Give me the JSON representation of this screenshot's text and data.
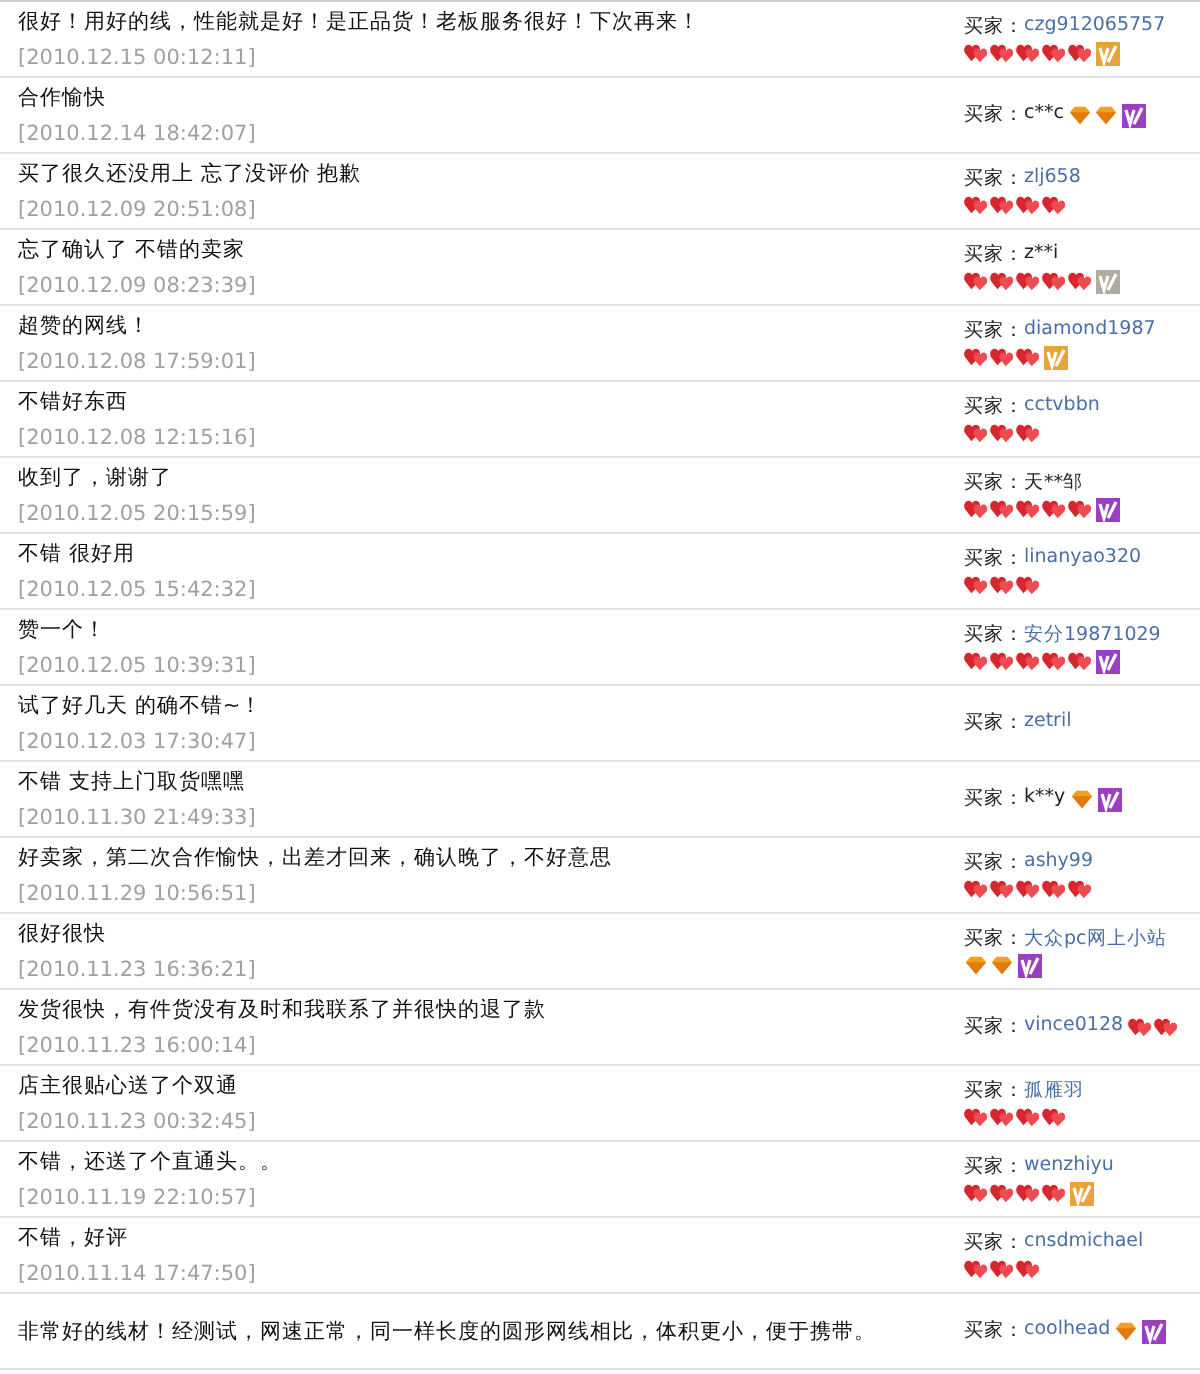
{
  "reviews": [
    {
      "comment": "很好！用好的线，性能就是好！是正品货！老板服务很好！下次再来！",
      "time": "[2010.12.15 00:12:11]",
      "buyer_label": "买家：",
      "buyer": "czg912065757",
      "masked": false,
      "rank_icons": [
        {
          "kind": "heart"
        },
        {
          "kind": "heart"
        },
        {
          "kind": "heart"
        },
        {
          "kind": "heart"
        },
        {
          "kind": "heart"
        }
      ],
      "vip": {
        "color": "#e8a33a"
      },
      "rank_inline": false
    },
    {
      "comment": "合作愉快",
      "time": "[2010.12.14 18:42:07]",
      "buyer_label": "买家：",
      "buyer": "c**c",
      "masked": true,
      "rank_icons": [
        {
          "kind": "diamond"
        },
        {
          "kind": "diamond"
        }
      ],
      "vip": {
        "color": "#9b3fc2"
      },
      "rank_inline": true
    },
    {
      "comment": "买了很久还没用上 忘了没评价 抱歉",
      "time": "[2010.12.09 20:51:08]",
      "buyer_label": "买家：",
      "buyer": "zlj658",
      "masked": false,
      "rank_icons": [
        {
          "kind": "heart"
        },
        {
          "kind": "heart"
        },
        {
          "kind": "heart"
        },
        {
          "kind": "heart"
        }
      ],
      "rank_inline": false
    },
    {
      "comment": "忘了确认了 不错的卖家",
      "time": "[2010.12.09 08:23:39]",
      "buyer_label": "买家：",
      "buyer": "z**i",
      "masked": true,
      "rank_icons": [
        {
          "kind": "heart"
        },
        {
          "kind": "heart"
        },
        {
          "kind": "heart"
        },
        {
          "kind": "heart"
        },
        {
          "kind": "heart"
        }
      ],
      "vip": {
        "color": "#b0aca0"
      },
      "rank_inline": false
    },
    {
      "comment": "超赞的网线！",
      "time": "[2010.12.08 17:59:01]",
      "buyer_label": "买家：",
      "buyer": "diamond1987",
      "masked": false,
      "rank_icons": [
        {
          "kind": "heart"
        },
        {
          "kind": "heart"
        },
        {
          "kind": "heart"
        }
      ],
      "vip": {
        "color": "#e8a33a"
      },
      "rank_inline": false
    },
    {
      "comment": "不错好东西",
      "time": "[2010.12.08 12:15:16]",
      "buyer_label": "买家：",
      "buyer": "cctvbbn",
      "masked": false,
      "rank_icons": [
        {
          "kind": "heart"
        },
        {
          "kind": "heart"
        },
        {
          "kind": "heart"
        }
      ],
      "rank_inline": false
    },
    {
      "comment": "收到了，谢谢了",
      "time": "[2010.12.05 20:15:59]",
      "buyer_label": "买家：",
      "buyer": "天**邹",
      "masked": true,
      "rank_icons": [
        {
          "kind": "heart"
        },
        {
          "kind": "heart"
        },
        {
          "kind": "heart"
        },
        {
          "kind": "heart"
        },
        {
          "kind": "heart"
        }
      ],
      "vip": {
        "color": "#9b3fc2"
      },
      "rank_inline": false
    },
    {
      "comment": "不错 很好用",
      "time": "[2010.12.05 15:42:32]",
      "buyer_label": "买家：",
      "buyer": "linanyao320",
      "masked": false,
      "rank_icons": [
        {
          "kind": "heart"
        },
        {
          "kind": "heart"
        },
        {
          "kind": "heart"
        }
      ],
      "rank_inline": false
    },
    {
      "comment": "赞一个！",
      "time": "[2010.12.05 10:39:31]",
      "buyer_label": "买家：",
      "buyer": "安分19871029",
      "masked": false,
      "rank_icons": [
        {
          "kind": "heart"
        },
        {
          "kind": "heart"
        },
        {
          "kind": "heart"
        },
        {
          "kind": "heart"
        },
        {
          "kind": "heart"
        }
      ],
      "vip": {
        "color": "#9b3fc2"
      },
      "rank_inline": false
    },
    {
      "comment": "试了好几天 的确不错~！",
      "time": "[2010.12.03 17:30:47]",
      "buyer_label": "买家：",
      "buyer": "zetril",
      "masked": false
    },
    {
      "comment": "不错 支持上门取货嘿嘿",
      "time": "[2010.11.30 21:49:33]",
      "buyer_label": "买家：",
      "buyer": "k**y",
      "masked": true,
      "rank_icons": [
        {
          "kind": "diamond"
        }
      ],
      "vip": {
        "color": "#9b3fc2"
      },
      "rank_inline": true
    },
    {
      "comment": "好卖家，第二次合作愉快，出差才回来，确认晚了，不好意思",
      "time": "[2010.11.29 10:56:51]",
      "buyer_label": "买家：",
      "buyer": "ashy99",
      "masked": false,
      "rank_icons": [
        {
          "kind": "heart"
        },
        {
          "kind": "heart"
        },
        {
          "kind": "heart"
        },
        {
          "kind": "heart"
        },
        {
          "kind": "heart"
        }
      ],
      "rank_inline": false
    },
    {
      "comment": "很好很快",
      "time": "[2010.11.23 16:36:21]",
      "buyer_label": "买家：",
      "buyer": "大众pc网上小站",
      "masked": false,
      "rank_icons": [
        {
          "kind": "diamond"
        },
        {
          "kind": "diamond"
        }
      ],
      "vip": {
        "color": "#9b3fc2"
      },
      "rank_inline": false
    },
    {
      "comment": "发货很快，有件货没有及时和我联系了并很快的退了款",
      "time": "[2010.11.23 16:00:14]",
      "buyer_label": "买家：",
      "buyer": "vince0128",
      "masked": false,
      "rank_icons": [
        {
          "kind": "heart"
        },
        {
          "kind": "heart"
        }
      ],
      "rank_inline": true
    },
    {
      "comment": "店主很贴心送了个双通",
      "time": "[2010.11.23 00:32:45]",
      "buyer_label": "买家：",
      "buyer": "孤雁羽",
      "masked": false,
      "rank_icons": [
        {
          "kind": "heart"
        },
        {
          "kind": "heart"
        },
        {
          "kind": "heart"
        },
        {
          "kind": "heart"
        }
      ],
      "rank_inline": false
    },
    {
      "comment": "不错，还送了个直通头。。",
      "time": "[2010.11.19 22:10:57]",
      "buyer_label": "买家：",
      "buyer": "wenzhiyu",
      "masked": false,
      "rank_icons": [
        {
          "kind": "heart"
        },
        {
          "kind": "heart"
        },
        {
          "kind": "heart"
        },
        {
          "kind": "heart"
        }
      ],
      "vip": {
        "color": "#e8a33a"
      },
      "rank_inline": false
    },
    {
      "comment": "不错，好评",
      "time": "[2010.11.14 17:47:50]",
      "buyer_label": "买家：",
      "buyer": "cnsdmichael",
      "masked": false,
      "rank_icons": [
        {
          "kind": "heart"
        },
        {
          "kind": "heart"
        },
        {
          "kind": "heart"
        }
      ],
      "rank_inline": false
    },
    {
      "comment": "非常好的线材！经测试，网速正常，同一样长度的圆形网线相比，体积更小，便于携带。",
      "buyer_label": "买家：",
      "buyer": "coolhead",
      "masked": false,
      "rank_icons": [
        {
          "kind": "diamond"
        }
      ],
      "vip": {
        "color": "#9b3fc2"
      },
      "rank_inline": true
    }
  ]
}
